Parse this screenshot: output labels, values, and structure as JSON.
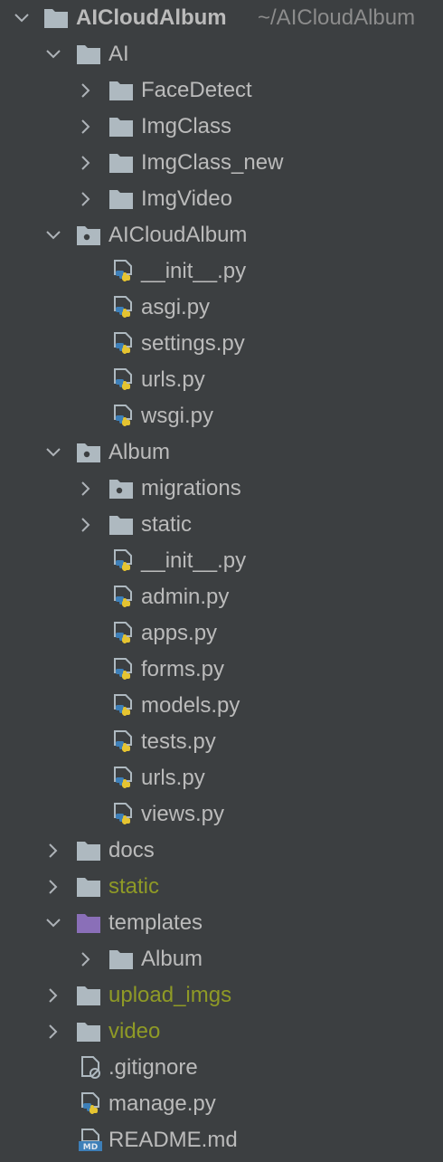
{
  "colors": {
    "background": "#3c3f41",
    "text": "#bbbbbb",
    "excluded_text": "#8f9a26",
    "folder": "#aeb9c0",
    "templates_folder": "#8a6fb8",
    "path_hint": "#8c8c8c"
  },
  "root": {
    "label": "AICloudAlbum",
    "path": "~/AICloudAlbum",
    "icon": "folder-icon"
  },
  "items": [
    {
      "label": "AI",
      "icon": "folder-icon",
      "chevron": "down",
      "depth": 1
    },
    {
      "label": "FaceDetect",
      "icon": "folder-icon",
      "chevron": "right",
      "depth": 2
    },
    {
      "label": "ImgClass",
      "icon": "folder-icon",
      "chevron": "right",
      "depth": 2
    },
    {
      "label": "ImgClass_new",
      "icon": "folder-icon",
      "chevron": "right",
      "depth": 2
    },
    {
      "label": "ImgVideo",
      "icon": "folder-icon",
      "chevron": "right",
      "depth": 2
    },
    {
      "label": "AICloudAlbum",
      "icon": "package-folder-icon",
      "chevron": "down",
      "depth": 1
    },
    {
      "label": "__init__.py",
      "icon": "python-file-icon",
      "chevron": "none",
      "depth": 2
    },
    {
      "label": "asgi.py",
      "icon": "python-file-icon",
      "chevron": "none",
      "depth": 2
    },
    {
      "label": "settings.py",
      "icon": "python-file-icon",
      "chevron": "none",
      "depth": 2
    },
    {
      "label": "urls.py",
      "icon": "python-file-icon",
      "chevron": "none",
      "depth": 2
    },
    {
      "label": "wsgi.py",
      "icon": "python-file-icon",
      "chevron": "none",
      "depth": 2
    },
    {
      "label": "Album",
      "icon": "package-folder-icon",
      "chevron": "down",
      "depth": 1
    },
    {
      "label": "migrations",
      "icon": "package-folder-icon",
      "chevron": "right",
      "depth": 2
    },
    {
      "label": "static",
      "icon": "folder-icon",
      "chevron": "right",
      "depth": 2
    },
    {
      "label": "__init__.py",
      "icon": "python-file-icon",
      "chevron": "none",
      "depth": 2
    },
    {
      "label": "admin.py",
      "icon": "python-file-icon",
      "chevron": "none",
      "depth": 2
    },
    {
      "label": "apps.py",
      "icon": "python-file-icon",
      "chevron": "none",
      "depth": 2
    },
    {
      "label": "forms.py",
      "icon": "python-file-icon",
      "chevron": "none",
      "depth": 2
    },
    {
      "label": "models.py",
      "icon": "python-file-icon",
      "chevron": "none",
      "depth": 2
    },
    {
      "label": "tests.py",
      "icon": "python-file-icon",
      "chevron": "none",
      "depth": 2
    },
    {
      "label": "urls.py",
      "icon": "python-file-icon",
      "chevron": "none",
      "depth": 2
    },
    {
      "label": "views.py",
      "icon": "python-file-icon",
      "chevron": "none",
      "depth": 2
    },
    {
      "label": "docs",
      "icon": "folder-icon",
      "chevron": "right",
      "depth": 1
    },
    {
      "label": "static",
      "icon": "folder-icon",
      "chevron": "right",
      "depth": 1,
      "excluded": true
    },
    {
      "label": "templates",
      "icon": "templates-folder-icon",
      "chevron": "down",
      "depth": 1
    },
    {
      "label": "Album",
      "icon": "folder-icon",
      "chevron": "right",
      "depth": 2
    },
    {
      "label": "upload_imgs",
      "icon": "folder-icon",
      "chevron": "right",
      "depth": 1,
      "excluded": true
    },
    {
      "label": "video",
      "icon": "folder-icon",
      "chevron": "right",
      "depth": 1,
      "excluded": true
    },
    {
      "label": ".gitignore",
      "icon": "gitignore-file-icon",
      "chevron": "none",
      "depth": 1
    },
    {
      "label": "manage.py",
      "icon": "python-file-icon",
      "chevron": "none",
      "depth": 1
    },
    {
      "label": "README.md",
      "icon": "markdown-file-icon",
      "chevron": "none",
      "depth": 1
    }
  ]
}
